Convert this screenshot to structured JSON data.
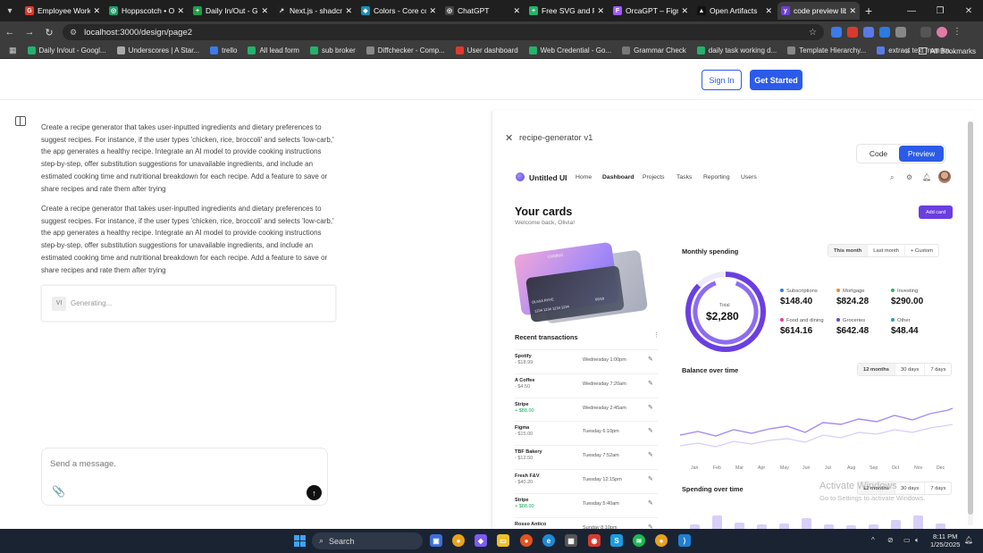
{
  "tabs": [
    {
      "title": "Employee Working",
      "color": "#e0392b",
      "glyph": "G",
      "active": false
    },
    {
      "title": "Hoppscotch • Op",
      "color": "#1e9e6a",
      "glyph": "◎",
      "active": false
    },
    {
      "title": "Daily In/Out - Go",
      "color": "#1e9e4a",
      "glyph": "+",
      "active": false
    },
    {
      "title": "Next.js - shadcn/",
      "color": "#222222",
      "glyph": "↗",
      "active": false
    },
    {
      "title": "Colors - Core con",
      "color": "#1a8fb0",
      "glyph": "◆",
      "active": false
    },
    {
      "title": "ChatGPT",
      "color": "#444444",
      "glyph": "◎",
      "active": false
    },
    {
      "title": "Free SVG and Re",
      "color": "#23b26b",
      "glyph": "+",
      "active": false
    },
    {
      "title": "OrcaGPT – Figma",
      "color": "#a259ff",
      "glyph": "F",
      "active": false
    },
    {
      "title": "Open Artifacts",
      "color": "#111111",
      "glyph": "▲",
      "active": false
    },
    {
      "title": "code preview lib",
      "color": "#6f3fd8",
      "glyph": "y",
      "active": true
    }
  ],
  "address": {
    "url": "localhost:3000/design/page2"
  },
  "bookmarks": [
    "Daily In/out - Googl...",
    "Underscores | A Star...",
    "trello",
    "All lead form",
    "sub broker",
    "Diffchecker - Comp...",
    "User dashboard",
    "Web Credential - Go...",
    "Grammar Check",
    "daily task working d...",
    "Template Hierarchy...",
    "extract text from im..."
  ],
  "bookmarks_all": "All Bookmarks",
  "header": {
    "signin": "Sign In",
    "get_started": "Get Started"
  },
  "chat": {
    "prompt1": "Create a recipe generator that takes user-inputted ingredients and dietary preferences to suggest recipes. For instance, if the user types 'chicken, rice, broccoli' and selects 'low-carb,' the app generates a healthy recipe. Integrate an AI model to provide cooking instructions step-by-step, offer substitution suggestions for unavailable ingredients, and include an estimated cooking time and nutritional breakdown for each recipe. Add a feature to save or share recipes and rate them after trying",
    "prompt2": "Create a recipe generator that takes user-inputted ingredients and dietary preferences to suggest recipes. For instance, if the user types 'chicken, rice, broccoli' and selects 'low-carb,' the app generates a healthy recipe. Integrate an AI model to provide cooking instructions step-by-step, offer substitution suggestions for unavailable ingredients, and include an estimated cooking time and nutritional breakdown for each recipe. Add a feature to save or share recipes and rate them after trying",
    "avatar": "VI",
    "generating": "Generating...",
    "placeholder": "Send a message."
  },
  "panel": {
    "title": "recipe-generator v1",
    "code": "Code",
    "preview": "Preview"
  },
  "preview": {
    "brand": "Untitled UI",
    "nav": [
      "Home",
      "Dashboard",
      "Projects",
      "Tasks",
      "Reporting",
      "Users"
    ],
    "heading": "Your cards",
    "welcome": "Welcome back, Olivia!",
    "add_card": "Add card",
    "card_brand": "Untitled",
    "card_name": "OLIVIA RHYE",
    "card_number": "1234 1234 1234 1234",
    "card_expiry": "06/28",
    "monthly": "Monthly spending",
    "monthly_tabs": [
      "This month",
      "Last month",
      "+ Custom"
    ],
    "total_label": "Total",
    "total": "$2,280",
    "categories": [
      {
        "name": "Subscriptions",
        "amount": "$148.40",
        "color": "#2f7fe8"
      },
      {
        "name": "Mortgage",
        "amount": "$824.28",
        "color": "#f08a2b"
      },
      {
        "name": "Investing",
        "amount": "$290.00",
        "color": "#20b46e"
      },
      {
        "name": "Food and dining",
        "amount": "$614.16",
        "color": "#e83a9e"
      },
      {
        "name": "Groceries",
        "amount": "$642.48",
        "color": "#6a3fe0"
      },
      {
        "name": "Other",
        "amount": "$48.44",
        "color": "#2a9ab5"
      }
    ],
    "recent": "Recent transactions",
    "transactions": [
      {
        "name": "Spotify",
        "amount": "- $18.99",
        "date": "Wednesday 1:00pm",
        "positive": false
      },
      {
        "name": "A Coffee",
        "amount": "- $4.50",
        "date": "Wednesday 7:20am",
        "positive": false
      },
      {
        "name": "Stripe",
        "amount": "+ $88.00",
        "date": "Wednesday 2:45am",
        "positive": true
      },
      {
        "name": "Figma",
        "amount": "- $15.00",
        "date": "Tuesday 6:10pm",
        "positive": false
      },
      {
        "name": "TBF Bakery",
        "amount": "- $12.50",
        "date": "Tuesday 7:52am",
        "positive": false
      },
      {
        "name": "Fresh F&V",
        "amount": "- $40.20",
        "date": "Tuesday 12:15pm",
        "positive": false
      },
      {
        "name": "Stripe",
        "amount": "+ $88.00",
        "date": "Tuesday 5:40am",
        "positive": true
      },
      {
        "name": "Rosso Antico",
        "amount": "",
        "date": "Sunday 8:10pm",
        "positive": false
      }
    ],
    "balance": "Balance over time",
    "balance_tabs": [
      "12 months",
      "30 days",
      "7 days"
    ],
    "months": [
      "Jan",
      "Feb",
      "Mar",
      "Apr",
      "May",
      "Jun",
      "Jul",
      "Aug",
      "Sep",
      "Oct",
      "Nov",
      "Dec"
    ],
    "spending": "Spending over time",
    "spending_tabs": [
      "12 months",
      "30 days",
      "7 days"
    ]
  },
  "watermark": {
    "line1": "Activate Windows",
    "line2": "Go to Settings to activate Windows."
  },
  "taskbar": {
    "search": "Search",
    "time": "8:11 PM",
    "date": "1/25/2025"
  }
}
